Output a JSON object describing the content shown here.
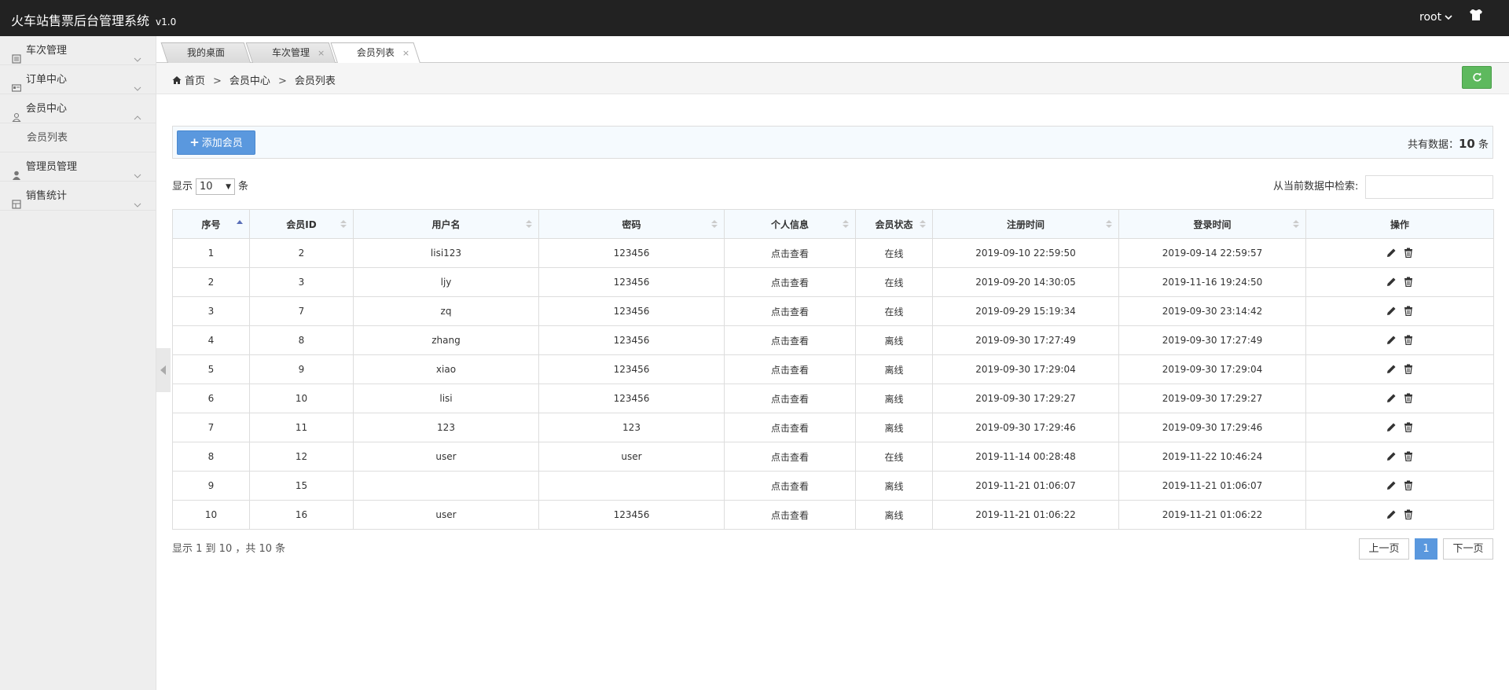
{
  "app": {
    "title": "火车站售票后台管理系统",
    "version": "v1.0"
  },
  "user": {
    "name": "root"
  },
  "sidebar": {
    "items": [
      {
        "label": "车次管理"
      },
      {
        "label": "订单中心"
      },
      {
        "label": "会员中心"
      },
      {
        "label": "管理员管理"
      },
      {
        "label": "销售统计"
      }
    ],
    "subitems": [
      {
        "label": "会员列表"
      }
    ]
  },
  "tabs": [
    {
      "label": "我的桌面"
    },
    {
      "label": "车次管理"
    },
    {
      "label": "会员列表"
    }
  ],
  "breadcrumb": {
    "home": "首页",
    "sep": ">",
    "level1": "会员中心",
    "level2": "会员列表"
  },
  "toolbar": {
    "add_label": "添加会员",
    "total_prefix": "共有数据：",
    "total_count": "10",
    "total_suffix": "条"
  },
  "length": {
    "prefix": "显示",
    "value": "10",
    "suffix": "条"
  },
  "filter": {
    "label": "从当前数据中检索:"
  },
  "table": {
    "columns": [
      "序号",
      "会员ID",
      "用户名",
      "密码",
      "个人信息",
      "会员状态",
      "注册时间",
      "登录时间",
      "操作"
    ],
    "rows": [
      {
        "seq": "1",
        "id": "2",
        "username": "lisi123",
        "password": "123456",
        "info": "点击查看",
        "status": "在线",
        "online": true,
        "reg": "2019-09-10 22:59:50",
        "login": "2019-09-14 22:59:57"
      },
      {
        "seq": "2",
        "id": "3",
        "username": "ljy",
        "password": "123456",
        "info": "点击查看",
        "status": "在线",
        "online": true,
        "reg": "2019-09-20 14:30:05",
        "login": "2019-11-16 19:24:50"
      },
      {
        "seq": "3",
        "id": "7",
        "username": "zq",
        "password": "123456",
        "info": "点击查看",
        "status": "在线",
        "online": true,
        "reg": "2019-09-29 15:19:34",
        "login": "2019-09-30 23:14:42"
      },
      {
        "seq": "4",
        "id": "8",
        "username": "zhang",
        "password": "123456",
        "info": "点击查看",
        "status": "离线",
        "online": false,
        "reg": "2019-09-30 17:27:49",
        "login": "2019-09-30 17:27:49"
      },
      {
        "seq": "5",
        "id": "9",
        "username": "xiao",
        "password": "123456",
        "info": "点击查看",
        "status": "离线",
        "online": false,
        "reg": "2019-09-30 17:29:04",
        "login": "2019-09-30 17:29:04"
      },
      {
        "seq": "6",
        "id": "10",
        "username": "lisi",
        "password": "123456",
        "info": "点击查看",
        "status": "离线",
        "online": false,
        "reg": "2019-09-30 17:29:27",
        "login": "2019-09-30 17:29:27"
      },
      {
        "seq": "7",
        "id": "11",
        "username": "123",
        "password": "123",
        "info": "点击查看",
        "status": "离线",
        "online": false,
        "reg": "2019-09-30 17:29:46",
        "login": "2019-09-30 17:29:46"
      },
      {
        "seq": "8",
        "id": "12",
        "username": "user",
        "password": "user",
        "info": "点击查看",
        "status": "在线",
        "online": true,
        "reg": "2019-11-14 00:28:48",
        "login": "2019-11-22 10:46:24"
      },
      {
        "seq": "9",
        "id": "15",
        "username": "",
        "password": "",
        "info": "点击查看",
        "status": "离线",
        "online": false,
        "reg": "2019-11-21 01:06:07",
        "login": "2019-11-21 01:06:07"
      },
      {
        "seq": "10",
        "id": "16",
        "username": "user",
        "password": "123456",
        "info": "点击查看",
        "status": "离线",
        "online": false,
        "reg": "2019-11-21 01:06:22",
        "login": "2019-11-21 01:06:22"
      }
    ]
  },
  "footer": {
    "info": "显示 1 到 10 ，共 10 条",
    "prev": "上一页",
    "current": "1",
    "next": "下一页"
  },
  "colors": {
    "topbar": "#222222",
    "primary": "#5a98de",
    "success": "#5eb95e",
    "online": "#31a131"
  },
  "icons": {
    "menu": [
      "train-icon",
      "order-icon",
      "member-icon",
      "admin-icon",
      "stats-icon"
    ],
    "topbar": "shirt-icon",
    "ops": [
      "edit-icon",
      "delete-icon"
    ]
  }
}
